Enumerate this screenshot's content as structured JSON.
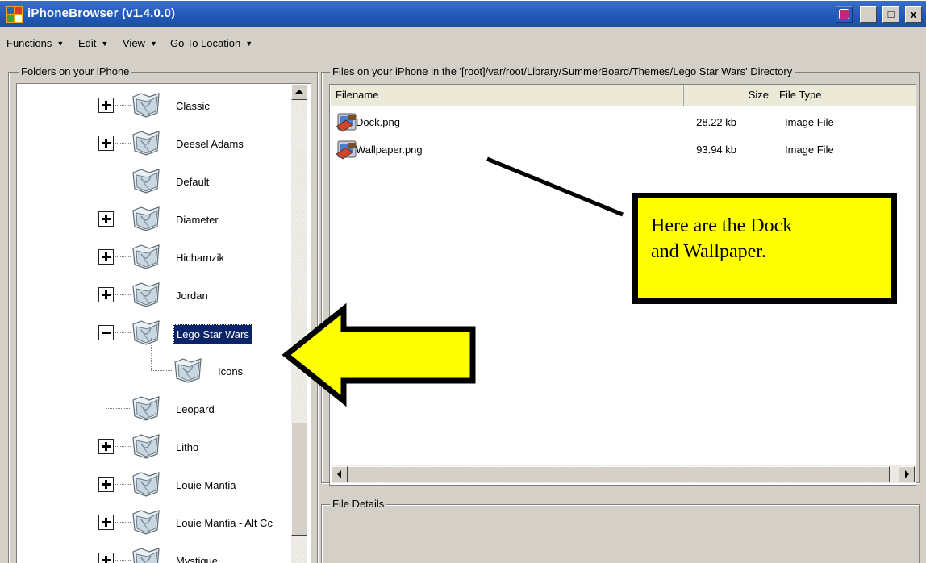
{
  "window": {
    "title": "iPhoneBrowser (v1.4.0.0)",
    "buttons": {
      "minimize": "_",
      "maximize": "□",
      "close": "x"
    }
  },
  "menubar": {
    "items": [
      {
        "label": "Functions",
        "mnemonic": "F"
      },
      {
        "label": "Edit",
        "mnemonic": "E"
      },
      {
        "label": "View",
        "mnemonic": "V"
      },
      {
        "label": "Go To Location",
        "mnemonic": "G"
      }
    ]
  },
  "left_panel": {
    "title": "Folders on your iPhone",
    "tree": [
      {
        "label": "Classic",
        "expander": "plus"
      },
      {
        "label": "Deesel Adams",
        "expander": "plus"
      },
      {
        "label": "Default",
        "expander": "none"
      },
      {
        "label": "Diameter",
        "expander": "plus"
      },
      {
        "label": "Hichamzik",
        "expander": "plus"
      },
      {
        "label": "Jordan",
        "expander": "plus"
      },
      {
        "label": "Lego Star Wars",
        "expander": "minus",
        "selected": true
      },
      {
        "label": "Icons",
        "expander": "none",
        "child": true
      },
      {
        "label": "Leopard",
        "expander": "none"
      },
      {
        "label": "Litho",
        "expander": "plus"
      },
      {
        "label": "Louie Mantia",
        "expander": "plus"
      },
      {
        "label": "Louie Mantia - Alt Cc",
        "expander": "plus"
      },
      {
        "label": "Mystique",
        "expander": "plus"
      }
    ]
  },
  "right_panel": {
    "title": "Files on your iPhone in the '[root]/var/root/Library/SummerBoard/Themes/Lego Star Wars' Directory",
    "columns": [
      "Filename",
      "Size",
      "File Type"
    ],
    "rows": [
      {
        "name": "Dock.png",
        "size": "28.22 kb",
        "type": "Image File"
      },
      {
        "name": "Wallpaper.png",
        "size": "93.94 kb",
        "type": "Image File"
      }
    ]
  },
  "details_panel": {
    "title": "File Details"
  },
  "annotation": {
    "callout_line1": "Here are the Dock",
    "callout_line2": "and Wallpaper.",
    "arrow_color": "#ffff00",
    "callout_color": "#ffff00"
  }
}
